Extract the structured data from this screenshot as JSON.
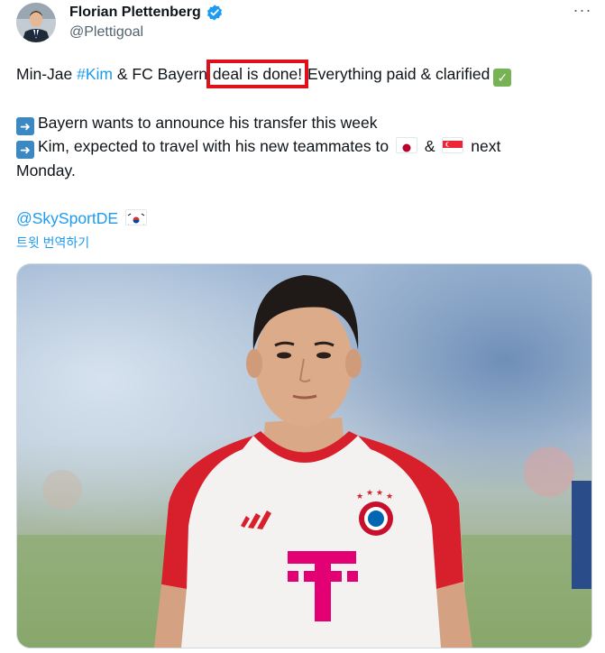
{
  "author": {
    "display_name": "Florian Plettenberg",
    "handle": "@Plettigoal",
    "avatar_icon": "profile-photo",
    "verified_icon": "verified-badge-icon"
  },
  "more_label": "···",
  "tweet": {
    "line1": {
      "prefix": "Min-Jae ",
      "hashtag": "#Kim",
      "middle": " & FC Bayern ",
      "highlighted": "deal is done!",
      "suffix": " Everything paid & clarified",
      "check_icon": "check-mark-emoji"
    },
    "line2": {
      "arrow_icon": "right-arrow-emoji",
      "text": "Bayern wants to announce his transfer this week"
    },
    "line3": {
      "arrow_icon": "right-arrow-emoji",
      "text_before": "Kim, expected to travel with his new teammates to",
      "flag1_icon": "japan-flag-emoji",
      "amp": "&",
      "flag2_icon": "singapore-flag-emoji",
      "text_after": "next"
    },
    "line4": "Monday.",
    "mention": "@SkySportDE",
    "mention_flag_icon": "south-korea-flag-emoji"
  },
  "translate_label": "트윗 번역하기",
  "media": {
    "image_icon": "player-photo",
    "accent_colors": {
      "jersey_red": "#d8202c",
      "jersey_white": "#f6f4f3",
      "sky": "#a9c6e3",
      "grass": "#8aa86a"
    }
  },
  "colors": {
    "link": "#1d9bf0",
    "highlight_box": "#e0101a",
    "verified": "#1d9bf0",
    "secondary_text": "#536471"
  }
}
